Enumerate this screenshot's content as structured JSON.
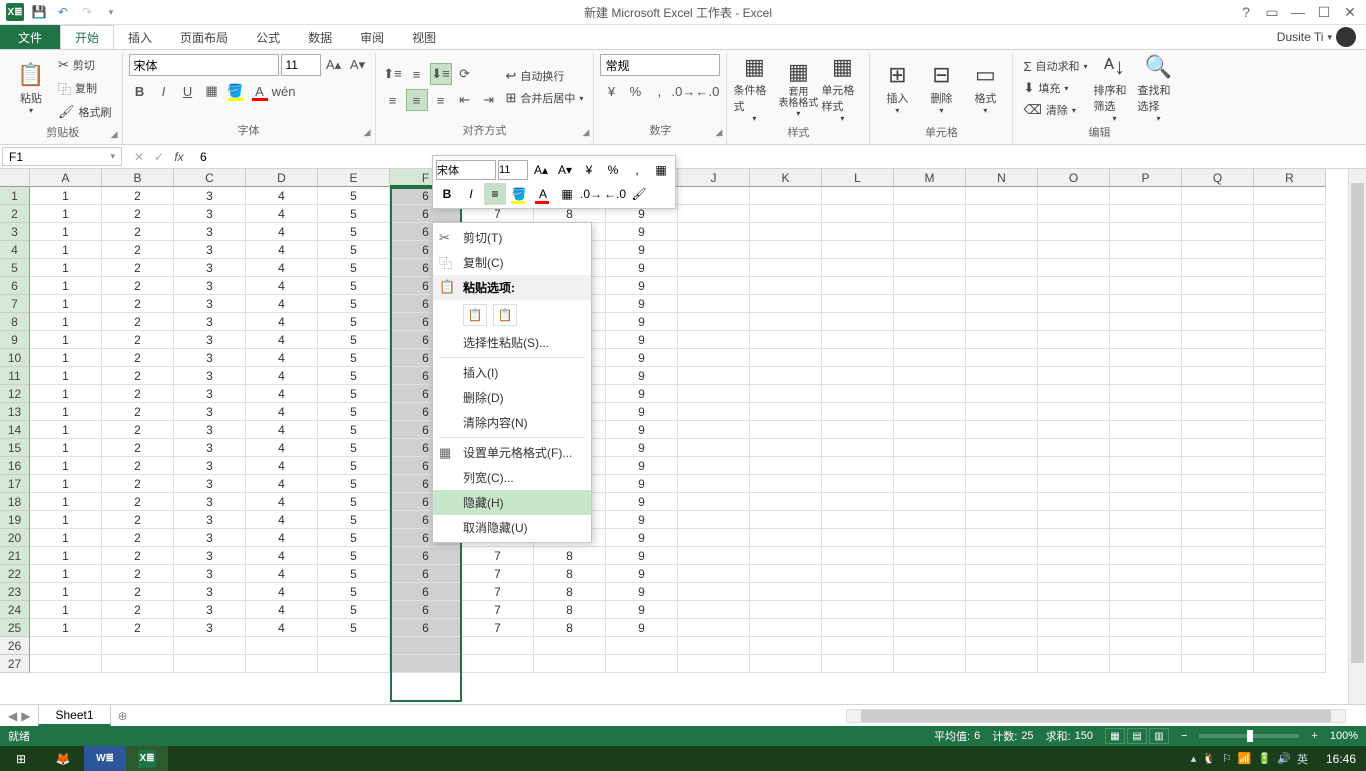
{
  "titlebar": {
    "title": "新建 Microsoft Excel 工作表 - Excel"
  },
  "tabs": {
    "file": "文件",
    "home": "开始",
    "insert": "插入",
    "page_layout": "页面布局",
    "formulas": "公式",
    "data": "数据",
    "review": "审阅",
    "view": "视图"
  },
  "user": {
    "name": "Dusite Ti"
  },
  "ribbon": {
    "clipboard": {
      "label": "剪贴板",
      "paste": "粘贴",
      "cut": "剪切",
      "copy": "复制",
      "format_painter": "格式刷"
    },
    "font": {
      "label": "字体",
      "name": "宋体",
      "size": "11"
    },
    "alignment": {
      "label": "对齐方式",
      "wrap": "自动换行",
      "merge": "合并后居中"
    },
    "number": {
      "label": "数字",
      "format": "常规"
    },
    "styles": {
      "label": "样式",
      "conditional": "条件格式",
      "table": "套用\n表格格式",
      "cell": "单元格样式"
    },
    "cells": {
      "label": "单元格",
      "insert": "插入",
      "delete": "删除",
      "format": "格式"
    },
    "editing": {
      "label": "编辑",
      "autosum": "自动求和",
      "fill": "填充",
      "clear": "清除",
      "sort": "排序和筛选",
      "find": "查找和选择"
    }
  },
  "name_box": "F1",
  "formula_value": "6",
  "columns": [
    "A",
    "B",
    "C",
    "D",
    "E",
    "F",
    "G",
    "H",
    "I",
    "J",
    "K",
    "L",
    "M",
    "N",
    "O",
    "P",
    "Q",
    "R"
  ],
  "selected_col_index": 5,
  "data_rows": 25,
  "row_values": [
    1,
    2,
    3,
    4,
    5,
    6,
    7,
    8,
    9
  ],
  "mini_toolbar": {
    "font": "宋体",
    "size": "11"
  },
  "context_menu": {
    "cut": "剪切(T)",
    "copy": "复制(C)",
    "paste_header": "粘贴选项:",
    "paste_special": "选择性粘贴(S)...",
    "insert": "插入(I)",
    "delete": "删除(D)",
    "clear": "清除内容(N)",
    "format_cells": "设置单元格格式(F)...",
    "col_width": "列宽(C)...",
    "hide": "隐藏(H)",
    "unhide": "取消隐藏(U)"
  },
  "sheet": {
    "name": "Sheet1"
  },
  "status": {
    "ready": "就绪",
    "avg_label": "平均值:",
    "avg_val": "6",
    "count_label": "计数:",
    "count_val": "25",
    "sum_label": "求和:",
    "sum_val": "150",
    "zoom": "100%"
  },
  "taskbar": {
    "ime": "英",
    "clock": "16:46"
  }
}
